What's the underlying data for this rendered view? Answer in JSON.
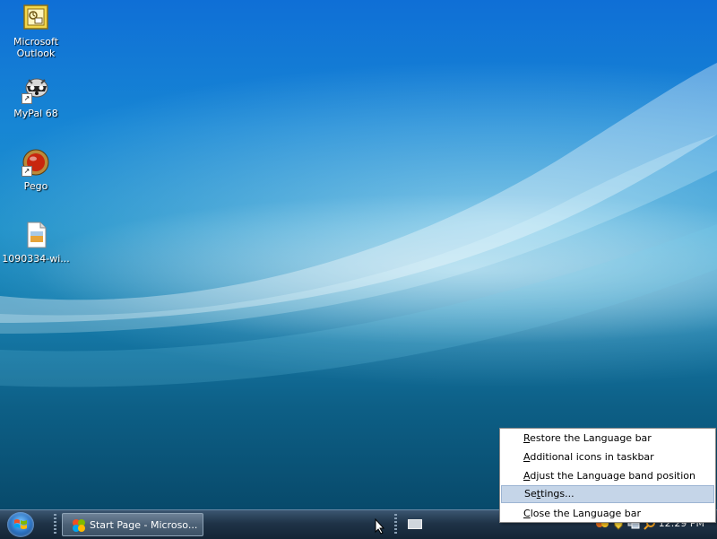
{
  "desktop": {
    "icons": [
      {
        "name": "microsoft-outlook",
        "label_line1": "Microsoft",
        "label_line2": "Outlook",
        "icon": "outlook-icon"
      },
      {
        "name": "mypal-68",
        "label_line1": "MyPal 68",
        "label_line2": "",
        "icon": "mypal-icon"
      },
      {
        "name": "pego",
        "label_line1": "Pego",
        "label_line2": "",
        "icon": "pego-icon"
      },
      {
        "name": "file-1090334",
        "label_line1": "1090334-wi...",
        "label_line2": "",
        "icon": "image-file-icon"
      }
    ]
  },
  "taskbar": {
    "task_button_label": "Start Page - Microso...",
    "clock": "12:29 PM"
  },
  "context_menu": {
    "items": [
      {
        "pre": "",
        "ul": "R",
        "post": "estore the Language bar"
      },
      {
        "pre": "",
        "ul": "A",
        "post": "dditional icons in taskbar"
      },
      {
        "pre": "",
        "ul": "A",
        "post": "djust the Language band position"
      },
      {
        "pre": "Se",
        "ul": "t",
        "post": "tings..."
      },
      {
        "pre": "",
        "ul": "C",
        "post": "lose the Language bar"
      }
    ],
    "selected_index": 3
  },
  "colors": {
    "accent_selection": "#c5d5e8",
    "taskbar": "#1f3347"
  }
}
